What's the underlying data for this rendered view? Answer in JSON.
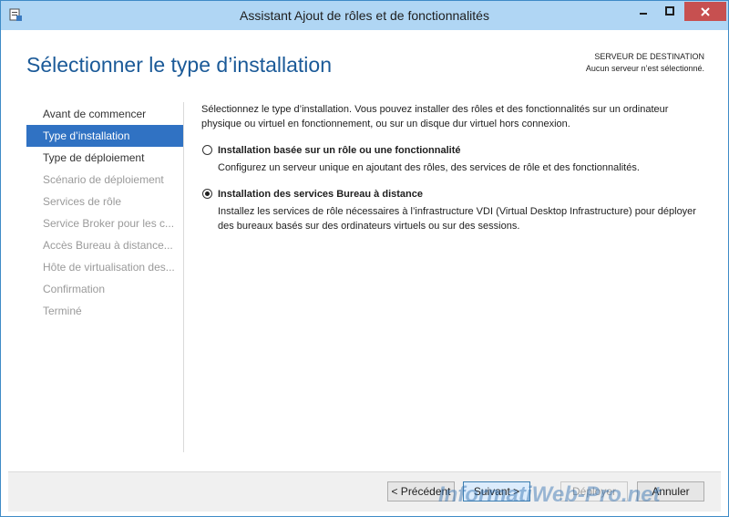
{
  "window": {
    "title": "Assistant Ajout de rôles et de fonctionnalités"
  },
  "header": {
    "page_title": "Sélectionner le type d’installation",
    "destination_label": "SERVEUR DE DESTINATION",
    "destination_value": "Aucun serveur n’est sélectionné."
  },
  "nav": {
    "items": [
      {
        "label": "Avant de commencer",
        "state": "done"
      },
      {
        "label": "Type d’installation",
        "state": "active"
      },
      {
        "label": "Type de déploiement",
        "state": "done"
      },
      {
        "label": "Scénario de déploiement",
        "state": "disabled"
      },
      {
        "label": "Services de rôle",
        "state": "disabled"
      },
      {
        "label": "Service Broker pour les c...",
        "state": "disabled"
      },
      {
        "label": "Accès Bureau à distance...",
        "state": "disabled"
      },
      {
        "label": "Hôte de virtualisation des...",
        "state": "disabled"
      },
      {
        "label": "Confirmation",
        "state": "disabled"
      },
      {
        "label": "Terminé",
        "state": "disabled"
      }
    ]
  },
  "content": {
    "intro": "Sélectionnez le type d’installation. Vous pouvez installer des rôles et des fonctionnalités sur un ordinateur physique ou virtuel en fonctionnement, ou sur un disque dur virtuel hors connexion.",
    "options": [
      {
        "title": "Installation basée sur un rôle ou une fonctionnalité",
        "description": "Configurez un serveur unique en ajoutant des rôles, des services de rôle et des fonctionnalités.",
        "checked": false
      },
      {
        "title": "Installation des services Bureau à distance",
        "description": "Installez les services de rôle nécessaires à l’infrastructure VDI (Virtual Desktop Infrastructure) pour déployer des bureaux basés sur des ordinateurs virtuels ou sur des sessions.",
        "checked": true
      }
    ]
  },
  "footer": {
    "previous": "< Précédent",
    "next": "Suivant >",
    "deploy": "Déployer",
    "cancel": "Annuler"
  },
  "watermark": "InformatiWeb-Pro.net",
  "colors": {
    "titlebar": "#b0d6f4",
    "accent": "#3072c3",
    "page_title": "#1b5a98",
    "close_button": "#c75050"
  }
}
